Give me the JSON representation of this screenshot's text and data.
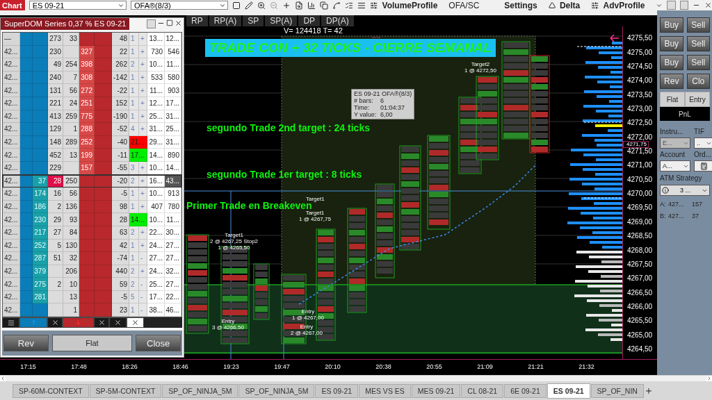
{
  "toolbar": {
    "title": "Chart",
    "instrument": "ES 09-21",
    "template": "OFA®(8/3)",
    "menu": [
      "VolumeProfile",
      "OFA/SC",
      "Settings",
      "Delta",
      "AdvProfile"
    ]
  },
  "chart_tabs": [
    "RP",
    "RP(A)",
    "SP",
    "SP(A)",
    "DP",
    "DP(A)"
  ],
  "superdom": {
    "title": "SuperDOM Series 0,37 % ES 09-21",
    "rows": [
      {
        "cells": [
          "—",
          "",
          "",
          "273",
          "33",
          "",
          "",
          "48",
          "1",
          "+",
          "13...",
          "12..."
        ],
        "current": false
      },
      {
        "cells": [
          "42...",
          "",
          "",
          "230",
          "",
          "327",
          "",
          "22",
          "1",
          "+",
          "730",
          "546"
        ],
        "current": false
      },
      {
        "cells": [
          "42...",
          "",
          "",
          "49",
          "254",
          "398",
          "",
          "262",
          "2",
          "+",
          "10...",
          "11..."
        ],
        "current": false
      },
      {
        "cells": [
          "42...",
          "",
          "",
          "240",
          "7",
          "308",
          "",
          "-142",
          "1",
          "+",
          "533",
          "580"
        ],
        "current": false
      },
      {
        "cells": [
          "42...",
          "",
          "",
          "131",
          "56",
          "272",
          "",
          "-22",
          "1",
          "+",
          "11...",
          "903"
        ],
        "current": false
      },
      {
        "cells": [
          "42...",
          "",
          "",
          "221",
          "24",
          "251",
          "",
          "152",
          "1",
          "+",
          "12...",
          "17..."
        ],
        "current": false
      },
      {
        "cells": [
          "42...",
          "",
          "",
          "413",
          "259",
          "775",
          "",
          "-190",
          "1",
          "+",
          "25...",
          "31..."
        ],
        "current": false
      },
      {
        "cells": [
          "42...",
          "",
          "",
          "129",
          "1",
          "288",
          "",
          "-52",
          "4",
          "+",
          "31...",
          "25..."
        ],
        "current": false
      },
      {
        "cells": [
          "42...",
          "",
          "",
          "148",
          "289",
          "252",
          "",
          "-40",
          "21...",
          "",
          "29...",
          "31..."
        ],
        "current": false,
        "color": "#ff0000"
      },
      {
        "cells": [
          "42...",
          "",
          "",
          "452",
          "13",
          "199",
          "",
          "-11",
          "17...",
          "",
          "14...",
          "890"
        ],
        "current": false,
        "color": "#00ee00"
      },
      {
        "cells": [
          "42...",
          "",
          "",
          "229",
          "",
          "157",
          "",
          "-55",
          "3",
          "+",
          "10...",
          "14..."
        ],
        "current": false
      },
      {
        "cells": [
          "42...",
          "",
          "37",
          "28",
          "250",
          "",
          "",
          "-20",
          "2",
          "+",
          "16...",
          "43..."
        ],
        "current": true
      },
      {
        "cells": [
          "42...",
          "",
          "174",
          "16",
          "56",
          "",
          "",
          "-5",
          "1",
          "+",
          "10...",
          "913"
        ],
        "current": false
      },
      {
        "cells": [
          "42...",
          "",
          "186",
          "2",
          "136",
          "",
          "",
          "98",
          "1",
          "+",
          "407",
          "780"
        ],
        "current": false
      },
      {
        "cells": [
          "42...",
          "",
          "230",
          "29",
          "93",
          "",
          "",
          "28",
          "14...",
          "",
          "10...",
          "11..."
        ],
        "current": false,
        "color": "#00ee00"
      },
      {
        "cells": [
          "42...",
          "",
          "217",
          "27",
          "84",
          "",
          "",
          "63",
          "2",
          "+",
          "22...",
          "30..."
        ],
        "current": false
      },
      {
        "cells": [
          "42...",
          "",
          "252",
          "5",
          "130",
          "",
          "",
          "42",
          "1",
          "+",
          "24...",
          "27..."
        ],
        "current": false
      },
      {
        "cells": [
          "42...",
          "",
          "287",
          "51",
          "32",
          "",
          "",
          "-74",
          "1",
          "-",
          "27...",
          "27..."
        ],
        "current": false
      },
      {
        "cells": [
          "42...",
          "",
          "379",
          "",
          "206",
          "",
          "",
          "440",
          "2",
          "+",
          "24...",
          "32..."
        ],
        "current": false
      },
      {
        "cells": [
          "42...",
          "",
          "275",
          "2",
          "10",
          "",
          "",
          "59",
          "2",
          "-",
          "25...",
          "27..."
        ],
        "current": false
      },
      {
        "cells": [
          "42...",
          "",
          "281",
          "",
          "13",
          "",
          "",
          "-5",
          "5",
          "-",
          "17...",
          "22..."
        ],
        "current": false
      },
      {
        "cells": [
          "42...",
          "",
          "",
          "",
          "1",
          "",
          "",
          "23",
          "1",
          "-",
          "38...",
          "46..."
        ],
        "current": false
      }
    ],
    "buttons": [
      "Rev",
      "Flat",
      "Close"
    ]
  },
  "chart": {
    "stats": "V= 124418 T= 42",
    "annotations": [
      {
        "kind": "banner",
        "text": "TRADE CON + 32 TICKS - CIERRE SEMANAL"
      },
      {
        "kind": "note",
        "text": "segundo Trade 2nd target : 24 ticks"
      },
      {
        "kind": "note",
        "text": "segundo Trade 1er target : 8 ticks"
      },
      {
        "kind": "note",
        "text": "Primer Trade en Breakeven"
      }
    ],
    "trade_labels": [
      {
        "lines": [
          "Target2",
          "1 @ 4272,50"
        ]
      },
      {
        "lines": [
          "Target1"
        ]
      },
      {
        "lines": [
          "Target1",
          "1 @ 4267,75"
        ]
      },
      {
        "lines": [
          "Target1",
          "2 @ 4267,25 Stop2",
          "1 @ 4265,50"
        ]
      },
      {
        "lines": [
          "Entry",
          "3 @ 4266,50"
        ]
      },
      {
        "lines": [
          "Entry",
          "1 @ 4267,00"
        ]
      },
      {
        "lines": [
          "Entry",
          "2 @ 4267,00"
        ]
      }
    ],
    "tooltip": {
      "title": "ES 09-21 OFA®(8/3)",
      "rows": [
        {
          "key": "# bars:",
          "value": "6"
        },
        {
          "key": "Time:",
          "value": "01:04:37"
        },
        {
          "key": "Y value:",
          "value": "6,00"
        }
      ]
    },
    "price_axis": [
      "4275,50",
      "4275,00",
      "4274,50",
      "4274,00",
      "4273,50",
      "4273,00",
      "4272,50",
      "4272,00",
      "4271,50",
      "4271,00",
      "4270,50",
      "4270,00",
      "4269,50",
      "4269,00",
      "4268,50",
      "4268,00",
      "4267,50",
      "4267,00",
      "4266,50",
      "4266,00",
      "4265,50",
      "4265,00",
      "4264,50"
    ],
    "current_price": "4271,75",
    "time_axis": [
      "17:15",
      "17:48",
      "18:26",
      "18:46",
      "19:23",
      "19:47",
      "20:10",
      "20:38",
      "20:55",
      "21:09",
      "21:21",
      "21:32"
    ]
  },
  "order_panel": {
    "buttons": [
      "Buy",
      "Sell",
      "Buy",
      "Sell",
      "Buy",
      "Sell",
      "Rev",
      "Clo"
    ],
    "flat": "Flat",
    "entry": "Entry",
    "pnl": "PnL",
    "fields": [
      {
        "label": "Instru...",
        "value": "E...",
        "disabled": true
      },
      {
        "label": "TIF",
        "value": "..",
        "disabled": false
      },
      {
        "label": "Account",
        "value": "A...",
        "disabled": false
      },
      {
        "label": "Ord..."
      }
    ],
    "atm_label": "ATM Strategy",
    "atm_value": "3 ...",
    "quotes": [
      {
        "side": "A:",
        "price": "427...",
        "size": "157"
      },
      {
        "side": "B:",
        "price": "427...",
        "size": "37"
      }
    ]
  },
  "tabs": [
    {
      "label": "SP-60M-CONTEXT",
      "selected": false
    },
    {
      "label": "SP-5M-CONTEXT",
      "selected": false
    },
    {
      "label": "SP_OF_NINJA_5M",
      "selected": false
    },
    {
      "label": "SP_OF_NINJA_5M",
      "selected": false
    },
    {
      "label": "ES 09-21",
      "selected": false
    },
    {
      "label": "MES VS ES",
      "selected": false
    },
    {
      "label": "MES 09-21",
      "selected": false
    },
    {
      "label": "CL 08-21",
      "selected": false
    },
    {
      "label": "6E 09-21",
      "selected": false
    },
    {
      "label": "ES 09-21",
      "selected": true
    },
    {
      "label": "SP_OF_NIN",
      "selected": false
    }
  ]
}
